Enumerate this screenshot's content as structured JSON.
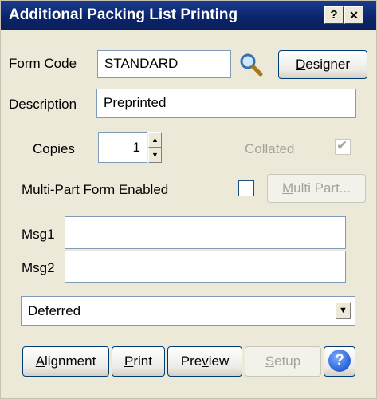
{
  "window": {
    "title": "Additional Packing List Printing",
    "help_glyph": "?",
    "close_glyph": "✕"
  },
  "form_code": {
    "label": "Form Code",
    "value": "STANDARD"
  },
  "designer_button": {
    "prefix": "",
    "mnemonic": "D",
    "suffix": "esigner"
  },
  "description": {
    "label": "Description",
    "value": "Preprinted"
  },
  "copies": {
    "label": "Copies",
    "value": "1"
  },
  "collated": {
    "label": "Collated",
    "checked": true,
    "enabled": false
  },
  "multipart": {
    "label": "Multi-Part Form Enabled",
    "checked": false,
    "button": {
      "prefix": "",
      "mnemonic": "M",
      "suffix": "ulti Part..."
    }
  },
  "msg1": {
    "label": "Msg1",
    "value": ""
  },
  "msg2": {
    "label": "Msg2",
    "value": ""
  },
  "print_mode": {
    "selected": "Deferred"
  },
  "buttons": {
    "alignment": {
      "prefix": "",
      "mnemonic": "A",
      "suffix": "lignment"
    },
    "print": {
      "prefix": "",
      "mnemonic": "P",
      "suffix": "rint"
    },
    "preview": {
      "prefix": "Pre",
      "mnemonic": "v",
      "suffix": "iew"
    },
    "setup": {
      "prefix": "",
      "mnemonic": "S",
      "suffix": "etup"
    }
  },
  "colors": {
    "titlebar": "#0a246a",
    "dialog": "#ece9d8",
    "help_icon": "#2a5fd6"
  }
}
